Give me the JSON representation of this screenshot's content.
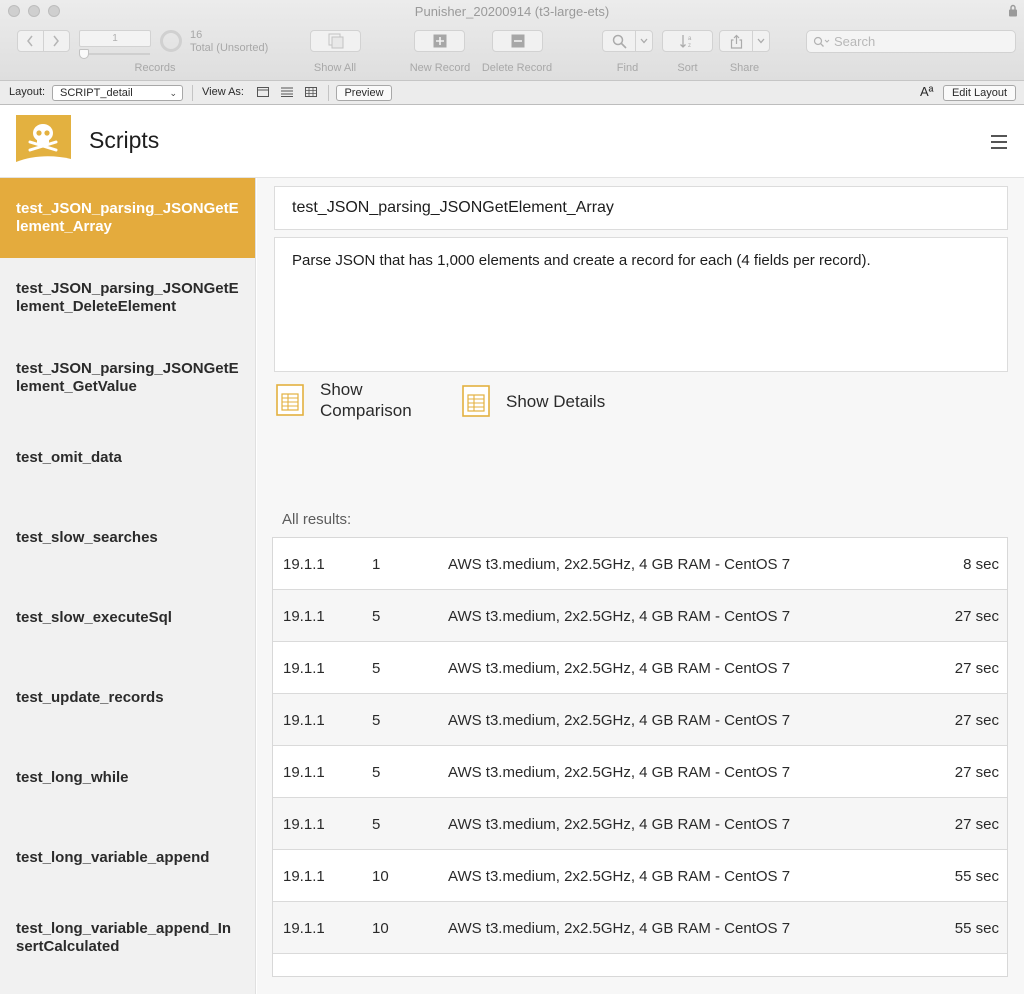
{
  "window": {
    "title": "Punisher_20200914 (t3-large-ets)"
  },
  "toolbar": {
    "record_number": "1",
    "total_count": "16",
    "total_label": "Total (Unsorted)",
    "records_label": "Records",
    "show_all_label": "Show All",
    "new_record_label": "New Record",
    "delete_record_label": "Delete Record",
    "find_label": "Find",
    "sort_label": "Sort",
    "share_label": "Share",
    "search_placeholder": "Search"
  },
  "layoutbar": {
    "layout_label": "Layout:",
    "layout_value": "SCRIPT_detail",
    "view_as_label": "View As:",
    "preview_label": "Preview",
    "edit_layout_label": "Edit Layout",
    "text_size_glyph": "Aª"
  },
  "header": {
    "title": "Scripts"
  },
  "sidebar": {
    "items": [
      {
        "label": "test_JSON_parsing_JSONGetElement_Array"
      },
      {
        "label": "test_JSON_parsing_JSONGetElement_DeleteElement"
      },
      {
        "label": "test_JSON_parsing_JSONGetElement_GetValue"
      },
      {
        "label": "test_omit_data"
      },
      {
        "label": "test_slow_searches"
      },
      {
        "label": "test_slow_executeSql"
      },
      {
        "label": "test_update_records"
      },
      {
        "label": "test_long_while"
      },
      {
        "label": "test_long_variable_append"
      },
      {
        "label": "test_long_variable_append_InsertCalculated"
      }
    ]
  },
  "detail": {
    "script_name": "test_JSON_parsing_JSONGetElement_Array",
    "description": "Parse JSON that has 1,000 elements and create a record for each (4 fields per record).",
    "show_comparison_label": "Show Comparison",
    "show_details_label": "Show Details",
    "results_label": "All results:"
  },
  "results": {
    "rows": [
      {
        "version": "19.1.1",
        "runs": "1",
        "environment": "AWS t3.medium, 2x2.5GHz, 4 GB RAM - CentOS 7",
        "duration": "8 sec"
      },
      {
        "version": "19.1.1",
        "runs": "5",
        "environment": "AWS t3.medium, 2x2.5GHz, 4 GB RAM - CentOS 7",
        "duration": "27 sec"
      },
      {
        "version": "19.1.1",
        "runs": "5",
        "environment": "AWS t3.medium, 2x2.5GHz, 4 GB RAM - CentOS 7",
        "duration": "27 sec"
      },
      {
        "version": "19.1.1",
        "runs": "5",
        "environment": "AWS t3.medium, 2x2.5GHz, 4 GB RAM - CentOS 7",
        "duration": "27 sec"
      },
      {
        "version": "19.1.1",
        "runs": "5",
        "environment": "AWS t3.medium, 2x2.5GHz, 4 GB RAM - CentOS 7",
        "duration": "27 sec"
      },
      {
        "version": "19.1.1",
        "runs": "5",
        "environment": "AWS t3.medium, 2x2.5GHz, 4 GB RAM - CentOS 7",
        "duration": "27 sec"
      },
      {
        "version": "19.1.1",
        "runs": "10",
        "environment": "AWS t3.medium, 2x2.5GHz, 4 GB RAM - CentOS 7",
        "duration": "55 sec"
      },
      {
        "version": "19.1.1",
        "runs": "10",
        "environment": "AWS t3.medium, 2x2.5GHz, 4 GB RAM - CentOS 7",
        "duration": "55 sec"
      }
    ]
  },
  "colors": {
    "accent": "#e4ab3d",
    "sidebar_bg": "#f1f1f1",
    "icon_accent": "#e3b140"
  },
  "icons": {
    "logo": "skull-icon",
    "menu": "hamburger-menu-icon",
    "show_comparison": "table-icon",
    "show_details": "table-icon"
  }
}
